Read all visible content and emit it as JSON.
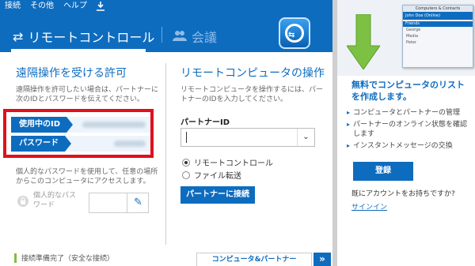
{
  "menu": {
    "items": [
      "接続",
      "その他",
      "ヘルプ"
    ]
  },
  "header": {
    "tab_remote": "リモートコントロール",
    "tab_meeting": "会議"
  },
  "left": {
    "title": "遠隔操作を受ける許可",
    "desc": "遠隔操作を許可したい場合は、パートナーに次のIDとパスワードを伝えてください。",
    "id_label": "使用中のID",
    "pw_label": "パスワード",
    "personal_desc": "個人的なパスワードを使用して、任意の場所からこのコンピュータにアクセスします。",
    "personal_label": "個人的なパスワード"
  },
  "right": {
    "title": "リモートコンピュータの操作",
    "desc": "リモートコンピュータを操作するには、パートナーのIDを入力してください。",
    "partner_label": "パートナーID",
    "partner_value": "",
    "radio_remote": "リモートコントロール",
    "radio_file": "ファイル転送",
    "connect_label": "パートナーに接続",
    "mode_selected": "remote"
  },
  "status": {
    "text": "接続準備完了（安全な接続）",
    "contacts_tab": "コンピュータ&パートナー",
    "indicator_color": "#7cc143"
  },
  "panel": {
    "mini_window": {
      "title": "Computers & Contacts",
      "user": "John Doe (Online)",
      "group": "Friends",
      "contacts": [
        "George",
        "Media",
        "Peter"
      ]
    },
    "promo_title": "無料でコンピュータのリストを作成します。",
    "bullets": [
      "コンピュータとパートナーの管理",
      "パートナーのオンライン状態を確認します",
      "インスタントメッセージの交換"
    ],
    "register_label": "登録",
    "has_account": "既にアカウントをお持ちですか?",
    "signin_label": "サインイン"
  },
  "colors": {
    "brand": "#0e6cbf",
    "highlight": "#e0101c",
    "arrow": "#7cc143"
  }
}
